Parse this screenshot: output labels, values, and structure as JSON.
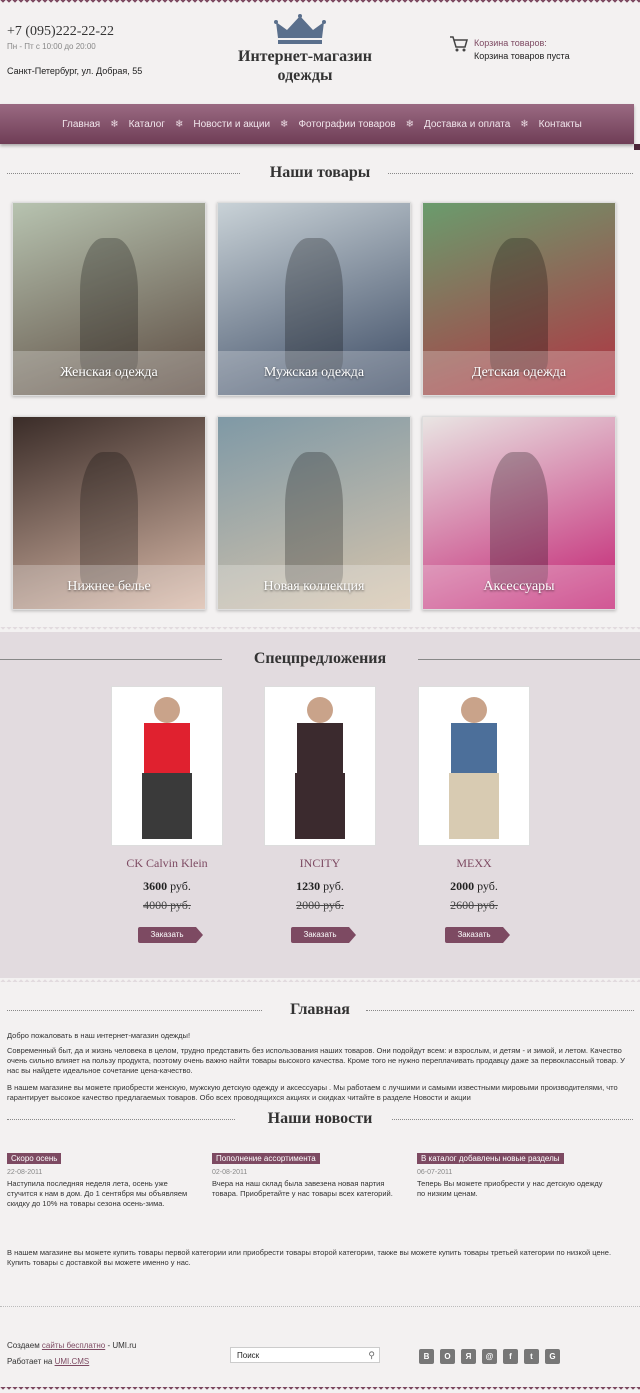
{
  "header": {
    "phone": "+7 (095)222-22-22",
    "hours": "Пн - Пт с 10:00 до 20:00",
    "address": "Санкт-Петербург, ул. Добрая, 55",
    "brand": "Интернет-магазин одежды",
    "cart_title": "Корзина товаров:",
    "cart_status": "Корзина товаров пуста"
  },
  "nav": {
    "items": [
      "Главная",
      "Каталог",
      "Новости и акции",
      "Фотографии товаров",
      "Доставка и оплата",
      "Контакты"
    ],
    "separator": "❄"
  },
  "products": {
    "title": "Наши товары",
    "tiles": [
      {
        "label": "Женская одежда",
        "c1": "#b7c3b0",
        "c2": "#5b4a40"
      },
      {
        "label": "Мужская одежда",
        "c1": "#c9d2d7",
        "c2": "#3b4a63"
      },
      {
        "label": "Детская одежда",
        "c1": "#6a9c6d",
        "c2": "#b13342"
      },
      {
        "label": "Нижнее белье",
        "c1": "#3a2c28",
        "c2": "#d9b9a8"
      },
      {
        "label": "Новая коллекция",
        "c1": "#7f99a6",
        "c2": "#d6c4ac"
      },
      {
        "label": "Аксессуары",
        "c1": "#e9e5e3",
        "c2": "#c21f71"
      }
    ]
  },
  "special": {
    "title": "Спецпредложения",
    "offers": [
      {
        "brand": "CK Calvin Klein",
        "price": "3600",
        "old_price": "4000",
        "currency": "руб.",
        "button": "Заказать",
        "top": "#e0212f",
        "bottom": "#3a3a3a"
      },
      {
        "brand": "INCITY",
        "price": "1230",
        "old_price": "2000",
        "currency": "руб.",
        "button": "Заказать",
        "top": "#3b2a2e",
        "bottom": "#3b2a2e"
      },
      {
        "brand": "MEXX",
        "price": "2000",
        "old_price": "2600",
        "currency": "руб.",
        "button": "Заказать",
        "top": "#4c6f9a",
        "bottom": "#d8cbb2"
      }
    ]
  },
  "main": {
    "title": "Главная",
    "welcome": "Добро пожаловать в наш интернет-магазин одежды!",
    "p1": "Современный быт, да и жизнь человека в целом, трудно представить без использования наших товаров. Они подойдут всем: и взрослым, и детям - и зимой, и летом. Качество очень сильно влияет на пользу продукта, поэтому очень важно найти товары высокого качества. Кроме того не нужно переплачивать продавцу даже за первоклассный товар. У нас вы найдете идеальное сочетание цена-качество.",
    "p2": "В нашем магазине вы можете приобрести женскую, мужскую детскую одежду и аксессуары . Мы работаем с лучшими и самыми известными мировыми производителями, что гарантирует высокое качество предлагаемых товаров. Обо всех проводящихся акциях и скидках читайте в разделе Новости и акции"
  },
  "news": {
    "title": "Наши новости",
    "items": [
      {
        "tag": "Скоро осень",
        "date": "22-08-2011",
        "body": "Наступила последняя неделя лета, осень уже стучится к нам в дом. До 1 сентября мы объявляем скидку до 10% на товары сезона осень-зима."
      },
      {
        "tag": "Пополнение ассортимента",
        "date": "02-08-2011",
        "body": "Вчера на наш склад была завезена новая партия товара. Приобретайте у нас товары всех категорий."
      },
      {
        "tag": "В каталог добавлены новые разделы",
        "date": "06-07-2011",
        "body": "Теперь Вы можете приобрести у нас детскую одежду по низким ценам."
      }
    ],
    "footer_text": "В нашем магазине вы можете купить товары первой категории или приобрести товары второй категории, также вы можете купить товары третьей категории по низкой цене. Купить товары с доставкой вы можете именно у нас."
  },
  "footer": {
    "created_prefix": "Создаем ",
    "created_link": "сайты бесплатно",
    "created_suffix": " - UMI.ru",
    "works_prefix": "Работает на ",
    "works_link": "UMI.CMS",
    "search_placeholder": "Поиск",
    "social": [
      "В",
      "О",
      "Я",
      "@",
      "f",
      "t",
      "G"
    ]
  }
}
